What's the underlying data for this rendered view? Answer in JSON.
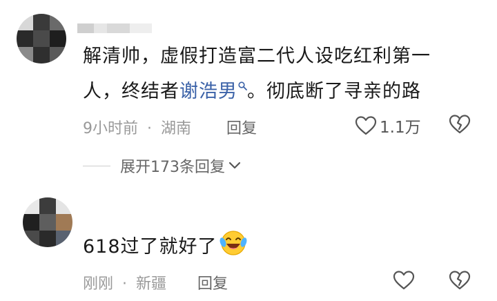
{
  "comments": [
    {
      "text_line1": "解清帅，虚假打造富二代人设吃红利第一",
      "text_line2_prefix": "人，终结者",
      "mention": "谢浩男",
      "text_line2_suffix": "。彻底断了寻亲的路",
      "time": "9小时前",
      "separator": "·",
      "location": "湖南",
      "reply_label": "回复",
      "like_count": "1.1万",
      "expand_label": "展开173条回复"
    },
    {
      "text": "618过了就好了",
      "emoji": "laughing-tears-emoji",
      "time": "刚刚",
      "separator": "·",
      "location": "新疆",
      "reply_label": "回复"
    }
  ],
  "colors": {
    "text": "#1a1a1a",
    "mention": "#3b62a8",
    "meta": "#999999",
    "icon": "#555555"
  }
}
